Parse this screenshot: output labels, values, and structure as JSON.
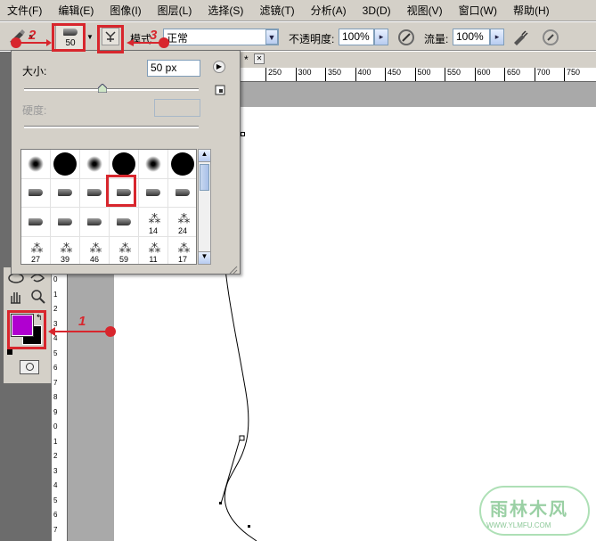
{
  "menubar": {
    "items": [
      "文件(F)",
      "编辑(E)",
      "图像(I)",
      "图层(L)",
      "选择(S)",
      "滤镜(T)",
      "分析(A)",
      "3D(D)",
      "视图(V)",
      "窗口(W)",
      "帮助(H)"
    ]
  },
  "options": {
    "brush_size_label": "50",
    "mode_label": "模式",
    "mode_value": "正常",
    "opacity_label": "不透明度:",
    "opacity_value": "100%",
    "flow_label": "流量:",
    "flow_value": "100%"
  },
  "brush_popup": {
    "size_label": "大小:",
    "size_value": "50 px",
    "hardness_label": "硬度:",
    "size_slider_fraction": 0.45,
    "presets": [
      {
        "kind": "soft",
        "num": ""
      },
      {
        "kind": "hard",
        "num": ""
      },
      {
        "kind": "soft",
        "num": ""
      },
      {
        "kind": "hard",
        "num": ""
      },
      {
        "kind": "soft",
        "num": ""
      },
      {
        "kind": "hard",
        "num": ""
      },
      {
        "kind": "tip",
        "num": ""
      },
      {
        "kind": "tip",
        "num": ""
      },
      {
        "kind": "tip",
        "num": ""
      },
      {
        "kind": "tip",
        "num": "",
        "selected": true
      },
      {
        "kind": "tip",
        "num": ""
      },
      {
        "kind": "tip",
        "num": ""
      },
      {
        "kind": "tip",
        "num": ""
      },
      {
        "kind": "tip",
        "num": ""
      },
      {
        "kind": "tip",
        "num": ""
      },
      {
        "kind": "tip",
        "num": ""
      },
      {
        "kind": "splat",
        "num": "14"
      },
      {
        "kind": "splat",
        "num": "24"
      },
      {
        "kind": "splat",
        "num": "27"
      },
      {
        "kind": "splat",
        "num": "39"
      },
      {
        "kind": "splat",
        "num": "46"
      },
      {
        "kind": "splat",
        "num": "59"
      },
      {
        "kind": "splat",
        "num": "11"
      },
      {
        "kind": "splat",
        "num": "17"
      }
    ]
  },
  "ruler": {
    "h_ticks": [
      "250",
      "300",
      "350",
      "400",
      "450",
      "500",
      "550",
      "600",
      "650",
      "700",
      "750"
    ],
    "v_ticks": [
      "0",
      "1",
      "2",
      "3",
      "4",
      "5",
      "6",
      "7",
      "8",
      "9",
      "0",
      "1",
      "2",
      "3",
      "4",
      "5",
      "6",
      "7"
    ]
  },
  "annotations": {
    "n1": "1",
    "n2": "2",
    "n3": "3"
  },
  "colors": {
    "foreground": "#b000d0",
    "background": "#000000",
    "annotation_red": "#d8262d"
  },
  "watermark": {
    "text": "雨林木风",
    "url": "WWW.YLMFU.COM"
  },
  "doc_tab": {
    "marker": "*",
    "close": "✕"
  }
}
